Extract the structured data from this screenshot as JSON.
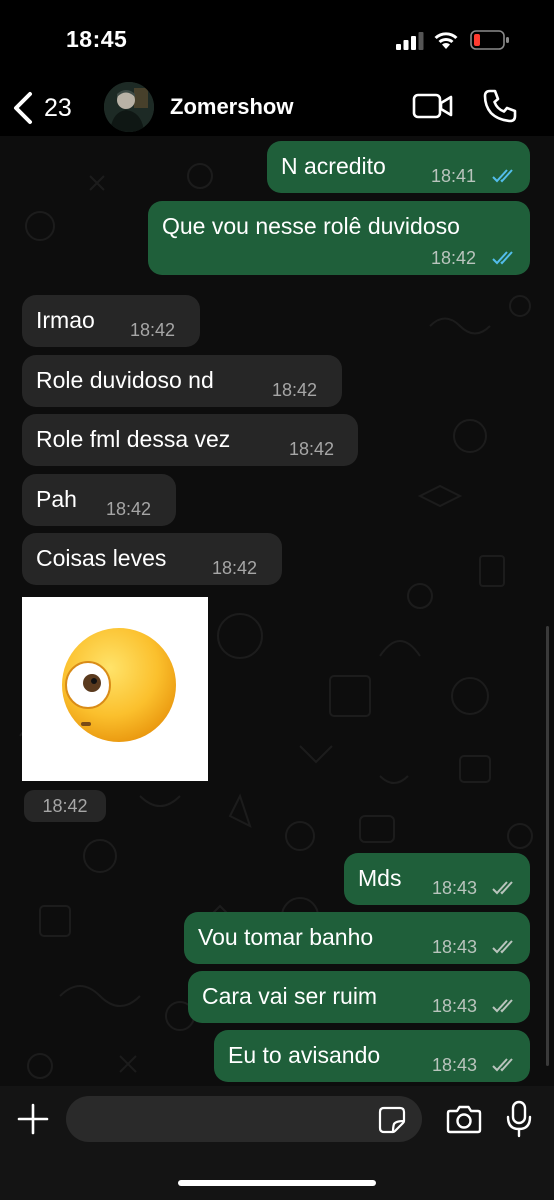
{
  "status_bar": {
    "time": "18:45"
  },
  "header": {
    "back_count": "23",
    "contact_name": "Zomershow"
  },
  "messages": [
    {
      "text": "N acredito",
      "time": "18:41",
      "direction": "out",
      "status": "read"
    },
    {
      "text": "Que vou nesse rolê duvidoso",
      "time": "18:42",
      "direction": "out",
      "status": "read"
    },
    {
      "text": "Irmao",
      "time": "18:42",
      "direction": "in"
    },
    {
      "text": "Role duvidoso nd",
      "time": "18:42",
      "direction": "in"
    },
    {
      "text": "Role fml dessa vez",
      "time": "18:42",
      "direction": "in"
    },
    {
      "text": "Pah",
      "time": "18:42",
      "direction": "in"
    },
    {
      "text": "Coisas leves",
      "time": "18:42",
      "direction": "in"
    },
    {
      "text": "Mds",
      "time": "18:43",
      "direction": "out",
      "status": "delivered"
    },
    {
      "text": "Vou tomar banho",
      "time": "18:43",
      "direction": "out",
      "status": "delivered"
    },
    {
      "text": "Cara vai ser ruim",
      "time": "18:43",
      "direction": "out",
      "status": "delivered"
    },
    {
      "text": "Eu to avisando",
      "time": "18:43",
      "direction": "out",
      "status": "delivered"
    }
  ],
  "sticker": {
    "emoji": "face-with-rolling-eye-sticker",
    "time": "18:42"
  },
  "input": {
    "placeholder": ""
  },
  "colors": {
    "outgoing_bubble": "#1f5f3a",
    "incoming_bubble": "#262626",
    "read_ticks": "#53bdeb",
    "delivered_ticks": "#b9c4bd",
    "battery_low": "#ff3b30"
  },
  "icons": [
    "back-chevron-icon",
    "video-call-icon",
    "phone-icon",
    "plus-icon",
    "sticker-icon",
    "camera-icon",
    "mic-icon"
  ]
}
